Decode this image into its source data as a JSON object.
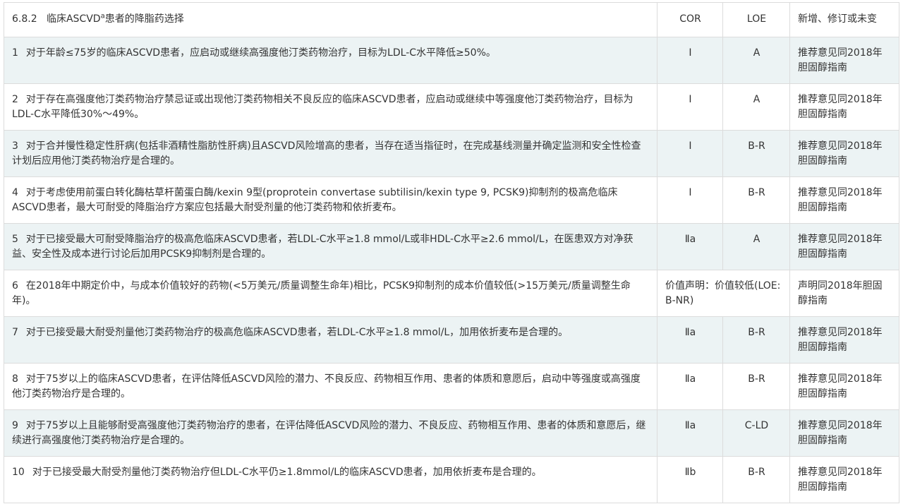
{
  "table": {
    "header": {
      "section": "6.8.2",
      "title_pre": "临床ASCVD",
      "title_sup": "a",
      "title_post": "患者的降脂药选择",
      "col_cor": "COR",
      "col_loe": "LOE",
      "col_status": "新增、修订或未变"
    },
    "rows": [
      {
        "num": "1",
        "text": "对于年龄≤75岁的临床ASCVD患者，应启动或继续高强度他汀类药物治疗，目标为LDL-C水平降低≥50%。",
        "cor": "Ⅰ",
        "loe": "A",
        "status": "推荐意见同2018年胆固醇指南"
      },
      {
        "num": "2",
        "text": "对于存在高强度他汀类药物治疗禁忌证或出现他汀类药物相关不良反应的临床ASCVD患者，应启动或继续中等强度他汀类药物治疗，目标为LDL-C水平降低30%～49%。",
        "cor": "Ⅰ",
        "loe": "A",
        "status": "推荐意见同2018年胆固醇指南"
      },
      {
        "num": "3",
        "text": "对于合并慢性稳定性肝病(包括非酒精性脂肪性肝病)且ASCVD风险增高的患者，当存在适当指征时，在完成基线测量并确定监测和安全性检查计划后应用他汀类药物治疗是合理的。",
        "cor": "Ⅰ",
        "loe": "B-R",
        "status": "推荐意见同2018年胆固醇指南"
      },
      {
        "num": "4",
        "text": "对于考虑使用前蛋白转化酶枯草杆菌蛋白酶/kexin 9型(proprotein convertase subtilisin/kexin type 9, PCSK9)抑制剂的极高危临床ASCVD患者，最大可耐受的降脂治疗方案应包括最大耐受剂量的他汀类药物和依折麦布。",
        "cor": "Ⅰ",
        "loe": "B-R",
        "status": "推荐意见同2018年胆固醇指南"
      },
      {
        "num": "5",
        "text": "对于已接受最大可耐受降脂治疗的极高危临床ASCVD患者，若LDL-C水平≥1.8 mmol/L或非HDL-C水平≥2.6 mmol/L，在医患双方对净获益、安全性及成本进行讨论后加用PCSK9抑制剂是合理的。",
        "cor": "Ⅱa",
        "loe": "A",
        "status": "推荐意见同2018年胆固醇指南"
      },
      {
        "num": "6",
        "text": "在2018年中期定价中，与成本价值较好的药物(<5万美元/质量调整生命年)相比，PCSK9抑制剂的成本价值较低(>15万美元/质量调整生命年)。",
        "cor": "价值声明：价值较低(LOE: B-NR)",
        "loe": "",
        "status": "声明同2018年胆固醇指南"
      },
      {
        "num": "7",
        "text": "对于已接受最大耐受剂量他汀类药物治疗的极高危临床ASCVD患者，若LDL-C水平≥1.8 mmol/L，加用依折麦布是合理的。",
        "cor": "Ⅱa",
        "loe": "B-R",
        "status": "推荐意见同2018年胆固醇指南"
      },
      {
        "num": "8",
        "text": "对于75岁以上的临床ASCVD患者，在评估降低ASCVD风险的潜力、不良反应、药物相互作用、患者的体质和意愿后，启动中等强度或高强度他汀类药物治疗是合理的。",
        "cor": "Ⅱa",
        "loe": "B-R",
        "status": "推荐意见同2018年胆固醇指南"
      },
      {
        "num": "9",
        "text": "对于75岁以上且能够耐受高强度他汀类药物治疗的患者，在评估降低ASCVD风险的潜力、不良反应、药物相互作用、患者的体质和意愿后，继续进行高强度他汀类药物治疗是合理的。",
        "cor": "Ⅱa",
        "loe": "C-LD",
        "status": "推荐意见同2018年胆固醇指南"
      },
      {
        "num": "10",
        "text": "对于已接受最大耐受剂量他汀类药物治疗但LDL-C水平仍≥1.8mmol/L的临床ASCVD患者，加用依折麦布是合理的。",
        "cor": "Ⅱb",
        "loe": "B-R",
        "status": "推荐意见同2018年胆固醇指南"
      }
    ]
  },
  "colors": {
    "border": "#dcdcdc",
    "shaded_row": "#ecf3f4",
    "text": "#333333"
  }
}
